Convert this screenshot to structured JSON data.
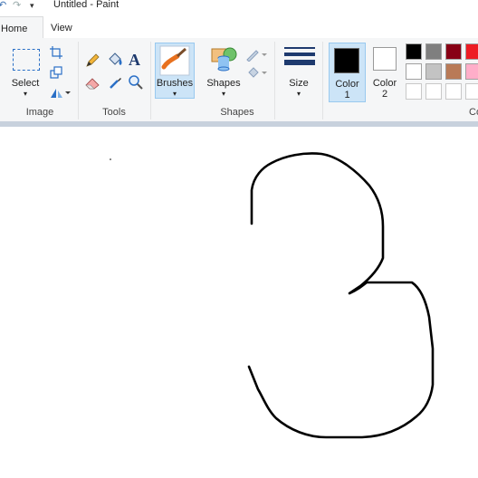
{
  "window": {
    "title": "Untitled - Paint"
  },
  "quick_access": {
    "undo_icon": "undo-icon",
    "redo_icon": "redo-icon",
    "menu_icon": "dropdown-icon"
  },
  "tabs": [
    {
      "label": "Home"
    },
    {
      "label": "View"
    }
  ],
  "ribbon": {
    "image_group": {
      "label": "Image",
      "select_label": "Select"
    },
    "tools_group": {
      "label": "Tools"
    },
    "brushes_label": "Brushes",
    "shapes_group": {
      "label": "Shapes",
      "shapes_label": "Shapes"
    },
    "size_label": "Size",
    "color1_label": "Color",
    "color1_num": "1",
    "color2_label": "Color",
    "color2_num": "2",
    "colors_group_label_partial": "Co",
    "color1_value": "#000000",
    "color2_value": "#ffffff",
    "palette_row1": [
      "#000000",
      "#7f7f7f",
      "#880015",
      "#ed1c24"
    ],
    "palette_row2": [
      "#ffffff",
      "#c3c3c3",
      "#b97a57",
      "#ffaec9"
    ]
  },
  "canvas": {
    "background": "#ffffff",
    "stroke_color": "#000000",
    "drawing": "handwritten digit 3"
  }
}
